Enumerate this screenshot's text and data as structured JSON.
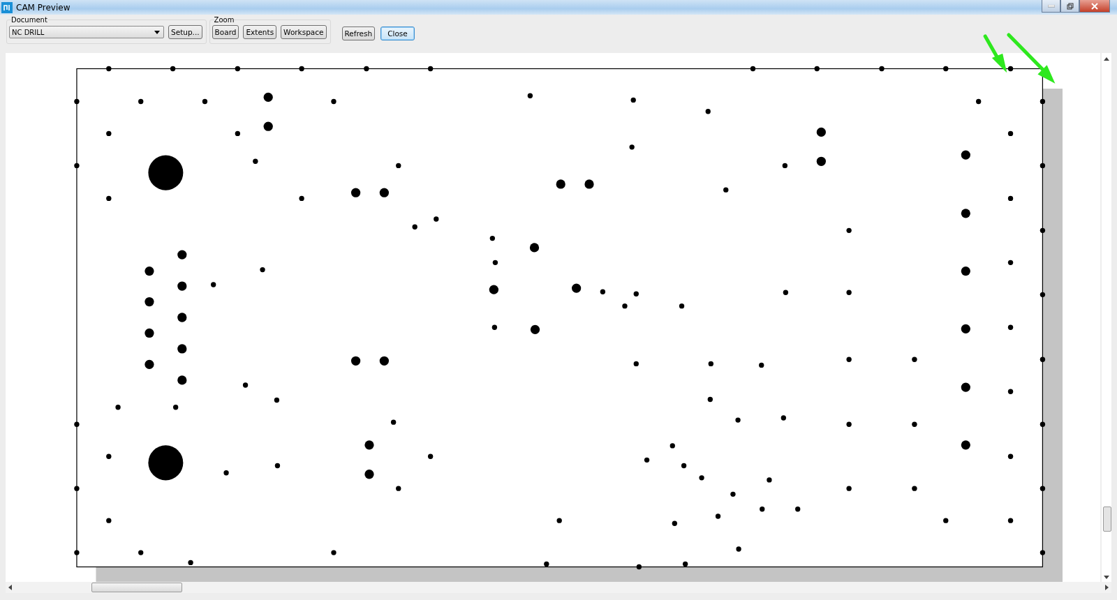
{
  "window": {
    "title": "CAM Preview"
  },
  "document_group": {
    "label": "Document",
    "dropdown": {
      "value": "NC DRILL"
    },
    "setup_button": "Setup..."
  },
  "zoom_group": {
    "label": "Zoom",
    "buttons": [
      "Board",
      "Extents",
      "Workspace"
    ]
  },
  "action_buttons": [
    {
      "label": "Refresh",
      "default": false
    },
    {
      "label": "Close",
      "default": true
    }
  ]
}
